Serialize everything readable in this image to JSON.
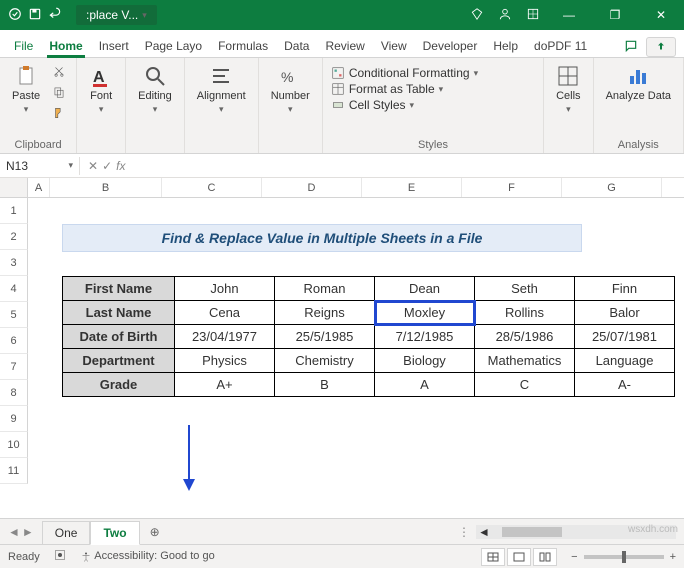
{
  "window": {
    "doc_name": ":place V...",
    "min": "—",
    "restore": "❐",
    "close": "✕"
  },
  "menu": {
    "file": "File",
    "home": "Home",
    "insert": "Insert",
    "page_layout": "Page Layo",
    "formulas": "Formulas",
    "data": "Data",
    "review": "Review",
    "view": "View",
    "developer": "Developer",
    "help": "Help",
    "dopdf": "doPDF 11"
  },
  "ribbon": {
    "clipboard": {
      "label": "Clipboard",
      "paste": "Paste"
    },
    "font": {
      "label": "Font",
      "btn": "Font"
    },
    "editing": {
      "label": "Editing",
      "btn": "Editing"
    },
    "alignment": {
      "label": "Alignment",
      "btn": "Alignment"
    },
    "number": {
      "label": "Number",
      "btn": "Number"
    },
    "styles": {
      "label": "Styles",
      "conditional": "Conditional Formatting",
      "table": "Format as Table",
      "cell": "Cell Styles"
    },
    "cells": {
      "label": "Cells",
      "btn": "Cells"
    },
    "analysis": {
      "label": "Analysis",
      "btn": "Analyze Data"
    }
  },
  "fx": {
    "namebox": "N13",
    "fx": "fx"
  },
  "columns": [
    "A",
    "B",
    "C",
    "D",
    "E",
    "F",
    "G"
  ],
  "rows": [
    "1",
    "2",
    "3",
    "4",
    "5",
    "6",
    "7",
    "8",
    "9",
    "10",
    "11"
  ],
  "title": "Find & Replace Value in Multiple Sheets in a File",
  "table": {
    "headers": [
      "First Name",
      "Last Name",
      "Date of Birth",
      "Department",
      "Grade"
    ],
    "cols": [
      [
        "John",
        "Cena",
        "23/04/1977",
        "Physics",
        "A+"
      ],
      [
        "Roman",
        "Reigns",
        "25/5/1985",
        "Chemistry",
        "B"
      ],
      [
        "Dean",
        "Moxley",
        "7/12/1985",
        "Biology",
        "A"
      ],
      [
        "Seth",
        "Rollins",
        "28/5/1986",
        "Mathematics",
        "C"
      ],
      [
        "Finn",
        "Balor",
        "25/07/1981",
        "Language",
        "A-"
      ]
    ],
    "selected": {
      "row": 1,
      "col": 2
    }
  },
  "tabs": {
    "one": "One",
    "two": "Two"
  },
  "status": {
    "ready": "Ready",
    "accessibility": "Accessibility: Good to go",
    "zoom": "+"
  },
  "watermark": "wsxdh.com"
}
